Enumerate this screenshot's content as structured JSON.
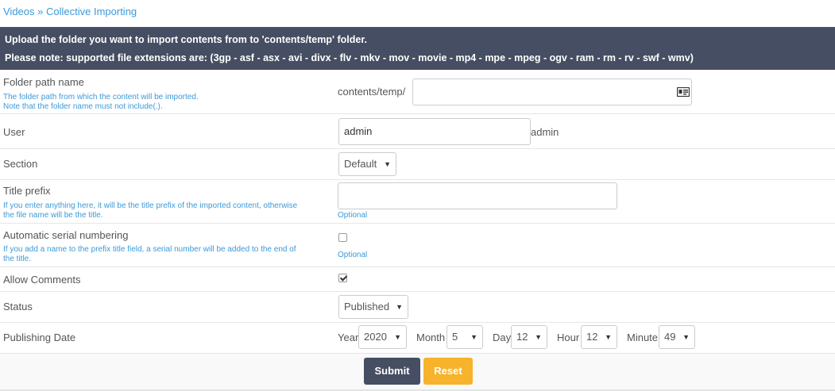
{
  "breadcrumb": {
    "parent": "Videos",
    "separator": "»",
    "current": "Collective Importing"
  },
  "header": {
    "line1_pre": "Upload the folder you want to import contents from to '",
    "line1_bold": "contents/temp",
    "line1_post": "' folder.",
    "line2": "Please note: supported file extensions are: (3gp - asf - asx - avi - divx - flv - mkv - mov - movie - mp4 - mpe - mpeg - ogv - ram - rm - rv - swf - wmv)"
  },
  "folder": {
    "label": "Folder path name",
    "hint1": "The folder path from which the content will be imported.",
    "hint2": "Note that the folder name must not include(.).",
    "prefix": "contents/temp/",
    "value": "",
    "icon": "id-card-icon"
  },
  "user": {
    "label": "User",
    "value": "admin",
    "display": "admin"
  },
  "section": {
    "label": "Section",
    "selected": "Default"
  },
  "title_prefix": {
    "label": "Title prefix",
    "hint1": "If you enter anything here, it will be the title prefix of the imported content, otherwise",
    "hint2": "the file name will be the title.",
    "value": "",
    "optional": "Optional"
  },
  "serial": {
    "label": "Automatic serial numbering",
    "hint1": "If you add a name to the prefix title field, a serial number will be added to the end of",
    "hint2": "the title.",
    "checked": false,
    "optional": "Optional"
  },
  "comments": {
    "label": "Allow Comments",
    "checked": true
  },
  "status": {
    "label": "Status",
    "selected": "Published"
  },
  "publishing": {
    "label": "Publishing Date",
    "year_label": "Year",
    "year": "2020",
    "month_label": "Month",
    "month": "5",
    "day_label": "Day",
    "day": "12",
    "hour_label": "Hour",
    "hour": "12",
    "minute_label": "Minute",
    "minute": "49"
  },
  "actions": {
    "submit": "Submit",
    "reset": "Reset"
  },
  "colors": {
    "header_bg": "#454e62",
    "link": "#3b9ad9",
    "reset_bg": "#f7b32b"
  }
}
